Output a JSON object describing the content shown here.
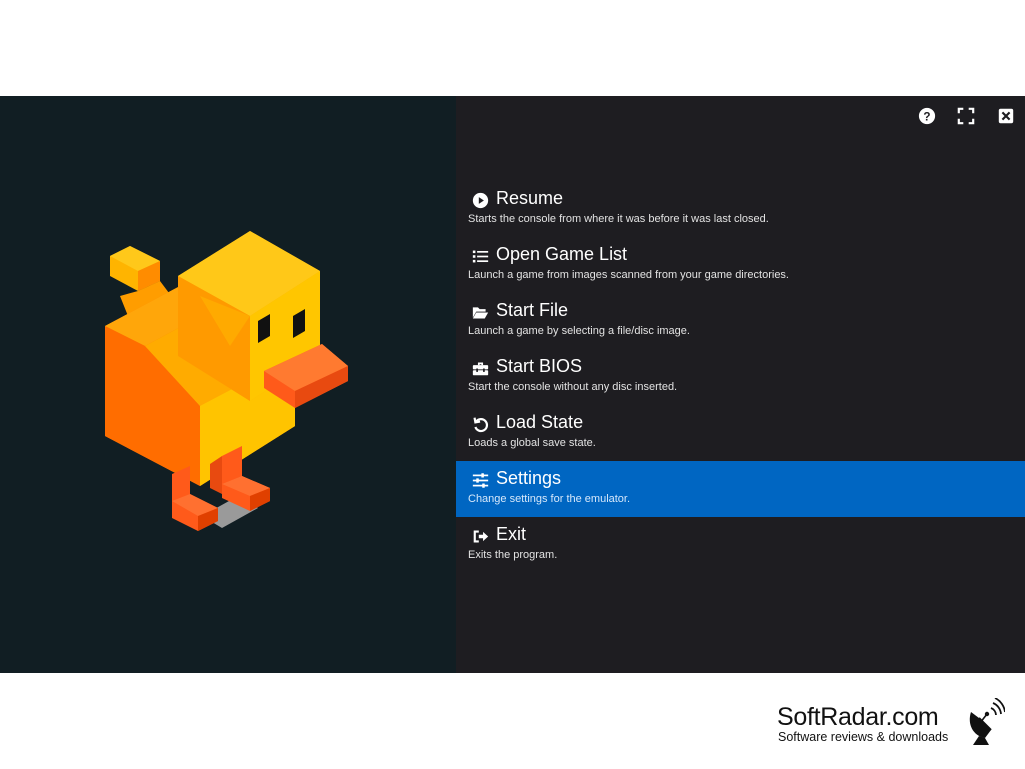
{
  "window": {
    "controls": [
      {
        "name": "help-icon"
      },
      {
        "name": "fullscreen-icon"
      },
      {
        "name": "close-icon"
      }
    ]
  },
  "menu": {
    "selected_index": 5,
    "items": [
      {
        "icon": "play-circle-icon",
        "title": "Resume",
        "description": "Starts the console from where it was before it was last closed."
      },
      {
        "icon": "list-icon",
        "title": "Open Game List",
        "description": "Launch a game from images scanned from your game directories."
      },
      {
        "icon": "folder-open-icon",
        "title": "Start File",
        "description": "Launch a game by selecting a file/disc image."
      },
      {
        "icon": "toolbox-icon",
        "title": "Start BIOS",
        "description": "Start the console without any disc inserted."
      },
      {
        "icon": "undo-icon",
        "title": "Load State",
        "description": "Loads a global save state."
      },
      {
        "icon": "sliders-icon",
        "title": "Settings",
        "description": "Change settings for the emulator."
      },
      {
        "icon": "sign-out-icon",
        "title": "Exit",
        "description": "Exits the program."
      }
    ]
  },
  "logo": {
    "icon": "duck-logo"
  },
  "watermark": {
    "name": "SoftRadar.com",
    "tagline": "Software reviews & downloads",
    "icon": "radar-dish-icon"
  },
  "colors": {
    "left_pane": "#111e23",
    "right_pane": "#1e1d21",
    "selected": "#0066c2",
    "duck_orange": "#ff9000",
    "duck_yellow": "#ffc400"
  }
}
